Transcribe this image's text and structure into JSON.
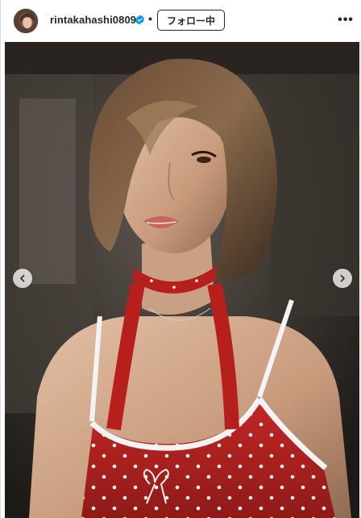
{
  "post": {
    "username": "rintakahashi0809",
    "separator": "•",
    "follow_label": "フォロー中",
    "more_label": "•••"
  },
  "icons": {
    "verified": "verified-badge-icon",
    "prev": "chevron-left-icon",
    "next": "chevron-right-icon",
    "more": "more-options-icon"
  },
  "colors": {
    "verified_blue": "#0095f6",
    "dress_red": "#b5201f",
    "text_dark": "#262626"
  }
}
